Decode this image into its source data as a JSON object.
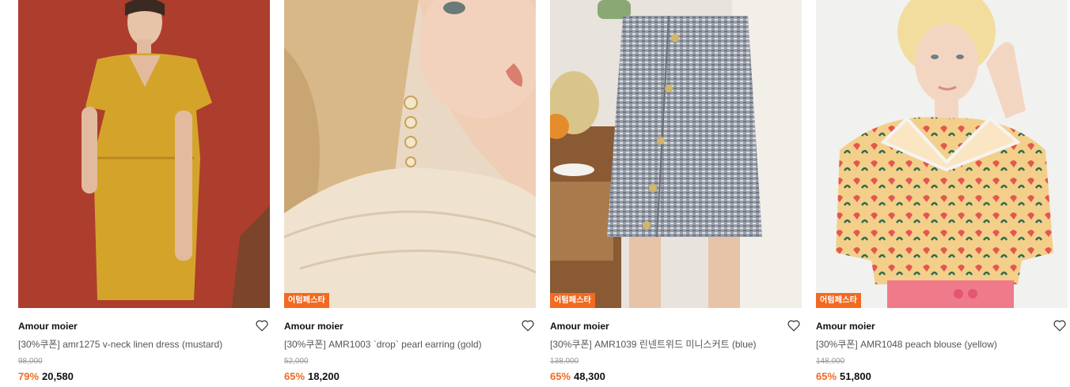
{
  "products": [
    {
      "brand": "Amour moier",
      "title": "[30%쿠폰] amr1275 v-neck linen dress (mustard)",
      "original_price": "98,000",
      "discount": "79%",
      "price": "20,580",
      "badge": "",
      "wishlist_icon": "heart-outline-icon"
    },
    {
      "brand": "Amour moier",
      "title": "[30%쿠폰] AMR1003 `drop` pearl earring (gold)",
      "original_price": "52,000",
      "discount": "65%",
      "price": "18,200",
      "badge": "어텀페스타",
      "wishlist_icon": "heart-outline-icon"
    },
    {
      "brand": "Amour moier",
      "title": "[30%쿠폰] AMR1039 린넨트위드 미니스커트 (blue)",
      "original_price": "138,000",
      "discount": "65%",
      "price": "48,300",
      "badge": "어텀페스타",
      "wishlist_icon": "heart-outline-icon"
    },
    {
      "brand": "Amour moier",
      "title": "[30%쿠폰] AMR1048 peach blouse (yellow)",
      "original_price": "148,000",
      "discount": "65%",
      "price": "51,800",
      "badge": "어텀페스타",
      "wishlist_icon": "heart-outline-icon"
    }
  ],
  "colors": {
    "accent": "#f26a21",
    "badge_bg": "#f26a21",
    "strikethrough": "#999999"
  }
}
